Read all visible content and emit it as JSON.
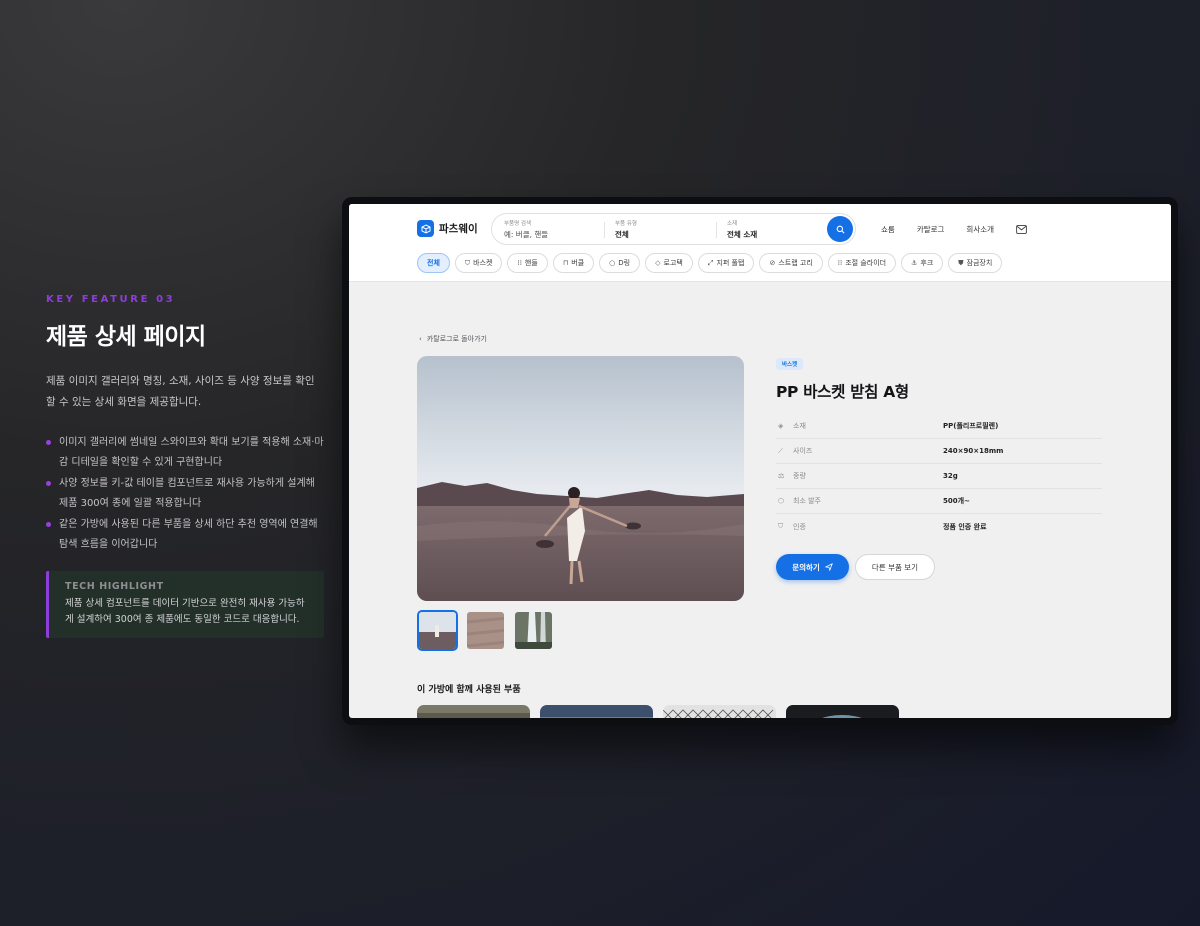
{
  "feature": {
    "eyebrow": "KEY FEATURE 03",
    "title": "제품 상세 페이지",
    "description": "제품 이미지 갤러리와 명칭, 소재, 사이즈 등 사양 정보를 확인할 수 있는 상세 화면을 제공합니다.",
    "bullets": [
      "이미지 갤러리에 썸네일 스와이프와 확대 보기를 적용해 소재·마감 디테일을 확인할 수 있게 구현합니다",
      "사양 정보를 키-값 테이블 컴포넌트로 재사용 가능하게 설계해 제품 300여 종에 일괄 적용합니다",
      "같은 가방에 사용된 다른 부품을 상세 하단 추천 영역에 연결해 탐색 흐름을 이어갑니다"
    ],
    "highlight": {
      "title": "TECH HIGHLIGHT",
      "text": "제품 상세 컴포넌트를 데이터 기반으로 완전히 재사용 가능하게 설계하여 300여 종 제품에도 동일한 코드로 대응합니다."
    }
  },
  "app": {
    "logo": "파츠웨이",
    "search": {
      "keyword_label": "부품명 검색",
      "keyword_placeholder": "예: 버클, 핸들",
      "type_label": "부품 유형",
      "type_value": "전체",
      "material_label": "소재",
      "material_value": "전체 소재"
    },
    "nav": [
      "쇼룸",
      "카탈로그",
      "회사소개"
    ],
    "chips": [
      {
        "label": "전체",
        "icon": "",
        "active": true
      },
      {
        "label": "바스켓",
        "icon": "basket-icon",
        "active": false
      },
      {
        "label": "핸들",
        "icon": "grid-icon",
        "active": false
      },
      {
        "label": "버클",
        "icon": "lock-icon",
        "active": false
      },
      {
        "label": "D링",
        "icon": "ring-icon",
        "active": false
      },
      {
        "label": "로고택",
        "icon": "tag-icon",
        "active": false
      },
      {
        "label": "지퍼 풀탭",
        "icon": "expand-icon",
        "active": false
      },
      {
        "label": "스트랩 고리",
        "icon": "link-icon",
        "active": false
      },
      {
        "label": "조절 슬라이더",
        "icon": "grid-icon",
        "active": false
      },
      {
        "label": "후크",
        "icon": "anchor-icon",
        "active": false
      },
      {
        "label": "잠금장치",
        "icon": "shield-icon",
        "active": false
      }
    ],
    "back_label": "카탈로그로 돌아가기",
    "product": {
      "badge": "바스켓",
      "title": "PP 바스켓 받침 A형",
      "specs": [
        {
          "icon": "layers-icon",
          "key": "소재",
          "value": "PP(폴리프로필렌)"
        },
        {
          "icon": "ruler-icon",
          "key": "사이즈",
          "value": "240×90×18mm"
        },
        {
          "icon": "scale-icon",
          "key": "중량",
          "value": "32g"
        },
        {
          "icon": "box-icon",
          "key": "최소 발주",
          "value": "500개~"
        },
        {
          "icon": "check-shield-icon",
          "key": "인증",
          "value": "정품 인증 완료"
        }
      ],
      "primary_button": "문의하기",
      "secondary_button": "다른 부품 보기"
    },
    "related_title": "이 가방에 함께 사용된 부품"
  },
  "colors": {
    "accent": "#1570e6",
    "feature_accent": "#8d3dd9"
  }
}
